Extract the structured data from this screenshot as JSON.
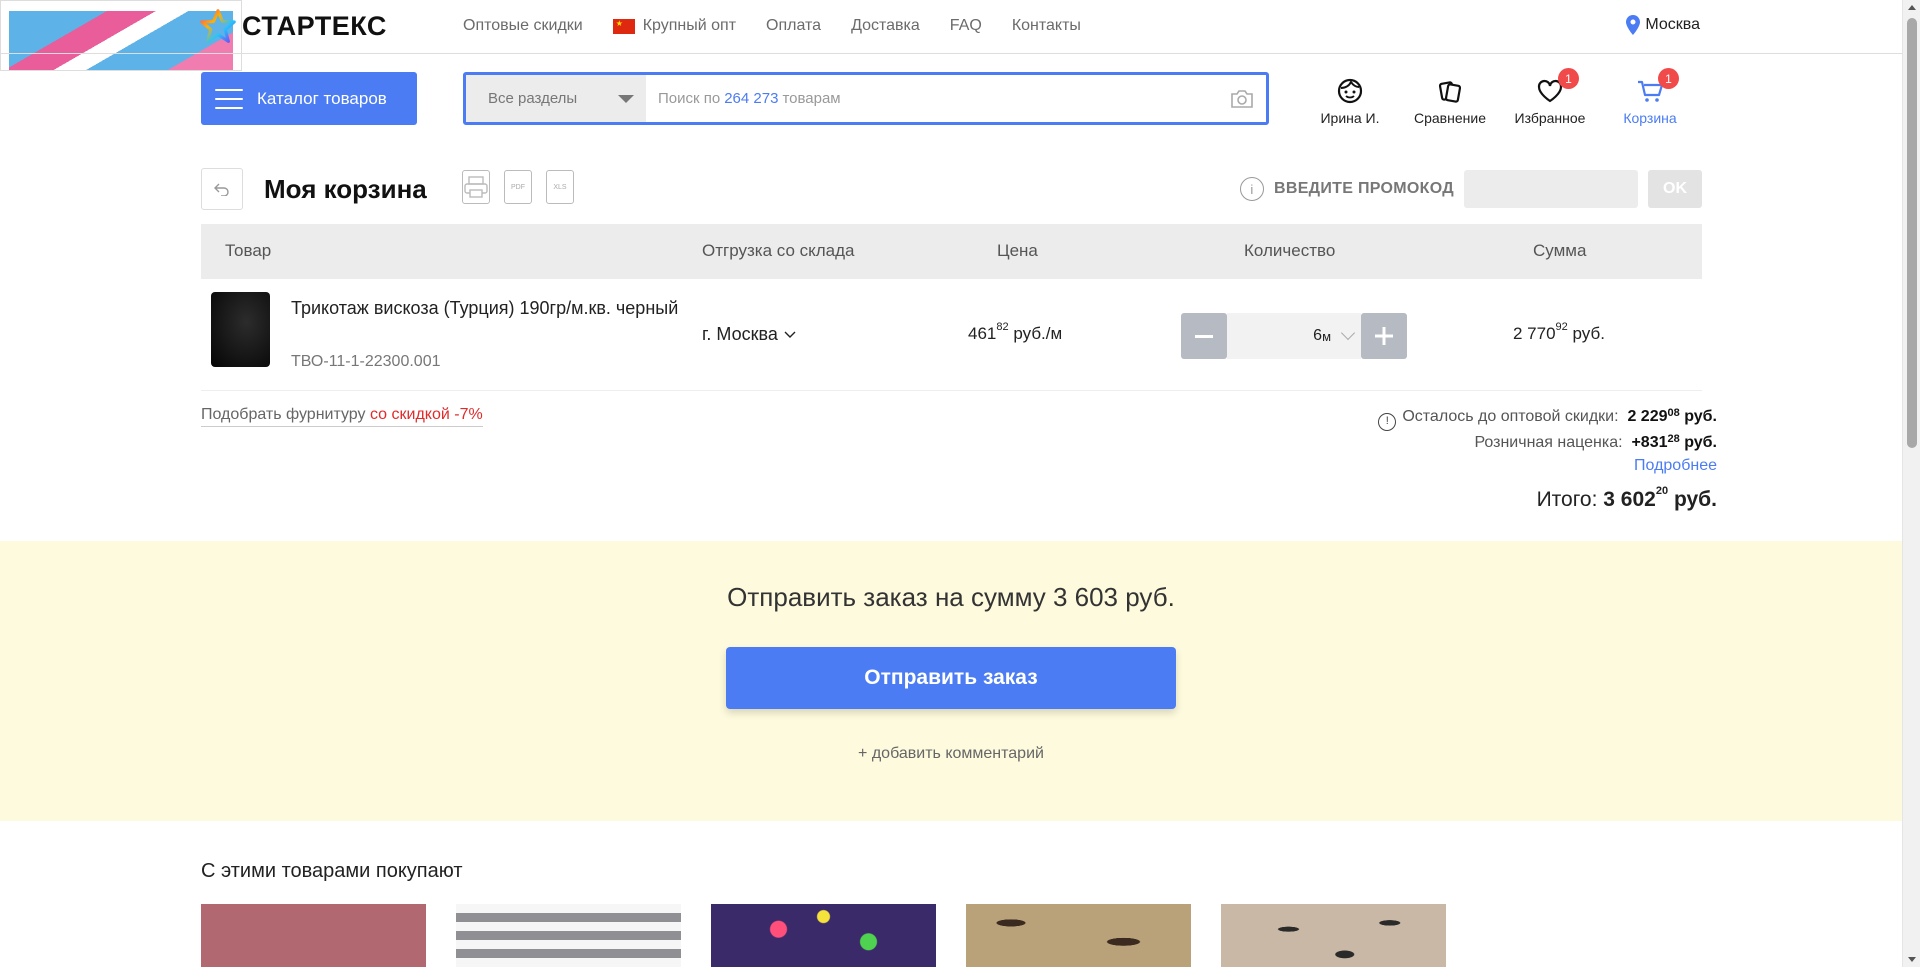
{
  "brand": {
    "name": "СТАРТЕКС"
  },
  "topnav": {
    "items": [
      {
        "label": "Оптовые скидки"
      },
      {
        "label": "Крупный опт"
      },
      {
        "label": "Оплата"
      },
      {
        "label": "Доставка"
      },
      {
        "label": "FAQ"
      },
      {
        "label": "Контакты"
      }
    ],
    "city": "Москва"
  },
  "header": {
    "catalog_label": "Каталог товаров",
    "search": {
      "section": "Все разделы",
      "prefix": "Поиск по",
      "count": "264 273",
      "suffix": "товарам"
    },
    "user_label": "Ирина И.",
    "compare_label": "Сравнение",
    "favorites_label": "Избранное",
    "favorites_badge": "1",
    "cart_label": "Корзина",
    "cart_badge": "1"
  },
  "cart": {
    "title": "Моя корзина",
    "promo_label": "ВВЕДИТЕ ПРОМОКОД",
    "promo_ok": "OK",
    "columns": {
      "product": "Товар",
      "warehouse": "Отгрузка со склада",
      "price": "Цена",
      "quantity": "Количество",
      "sum": "Сумма"
    },
    "items": [
      {
        "name": "Трикотаж вискоза (Турция) 190гр/м.кв. черный",
        "sku": "ТВО-11-1-22300.001",
        "warehouse": "г. Москва",
        "price_int": "461",
        "price_frac": "82",
        "price_unit": "руб./м",
        "qty": "6",
        "qty_unit": "м",
        "sum_int": "2 770",
        "sum_frac": "92",
        "sum_unit": "руб."
      }
    ],
    "fittings": {
      "prefix": "Подобрать фурнитуру",
      "discount": "со скидкой -7%"
    },
    "wholesale_label": "Осталось до оптовой скидки:",
    "wholesale_int": "2 229",
    "wholesale_frac": "08",
    "markup_label": "Розничная наценка:",
    "markup_int": "+831",
    "markup_frac": "28",
    "currency": "руб.",
    "more_link": "Подробнее",
    "total_label": "Итого:",
    "total_int": "3 602",
    "total_frac": "20",
    "total_unit": "руб."
  },
  "order": {
    "title": "Отправить заказ на сумму 3 603 руб.",
    "button": "Отправить заказ",
    "comment": "+ добавить комментарий"
  },
  "recommendations": {
    "title": "С этими товарами покупают"
  },
  "colors": {
    "accent": "#4b7cf3",
    "badge": "#f04a4a",
    "order_bg": "#fefadd",
    "discount": "#e02b2b"
  }
}
